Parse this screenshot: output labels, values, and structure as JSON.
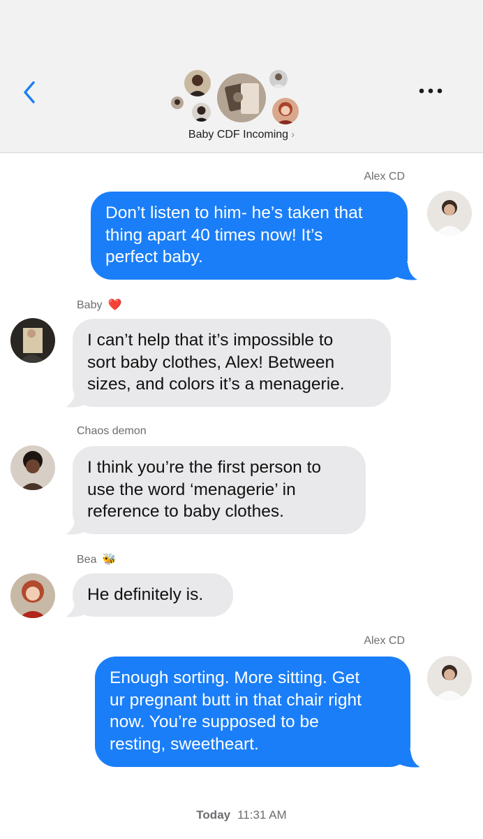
{
  "header": {
    "group_name": "Baby CDF Incoming",
    "chevron": "›",
    "back_icon": "chevron-left-icon",
    "more_icon": "ellipsis-icon",
    "accent_color": "#1a7ef8"
  },
  "messages": [
    {
      "sender": "Alex CD",
      "direction": "outgoing",
      "lines": [
        "Don’t listen to him- he’s taken that",
        "thing apart 40 times now! It’s",
        "perfect baby."
      ]
    },
    {
      "sender": "Baby",
      "sender_emoji": "❤️",
      "direction": "incoming",
      "lines": [
        "I can’t help that it’s impossible to",
        "sort baby clothes, Alex! Between",
        "sizes, and colors it’s a menagerie."
      ]
    },
    {
      "sender": "Chaos demon",
      "direction": "incoming",
      "lines": [
        "I think you’re the first person to",
        "use the word ‘menagerie’ in",
        "reference to baby clothes."
      ]
    },
    {
      "sender": "Bea",
      "sender_emoji": "🐝",
      "direction": "incoming",
      "lines": [
        "He definitely is."
      ]
    },
    {
      "sender": "Alex CD",
      "direction": "outgoing",
      "lines": [
        "Enough sorting. More sitting. Get",
        "ur pregnant butt in that chair right",
        "now. You’re supposed to be",
        "resting, sweetheart."
      ]
    }
  ],
  "footer": {
    "day": "Today",
    "time": "11:31 AM"
  },
  "colors": {
    "outgoing_bubble": "#1a7ef8",
    "incoming_bubble": "#e9e9eb",
    "header_bg": "#f2f2f2"
  }
}
